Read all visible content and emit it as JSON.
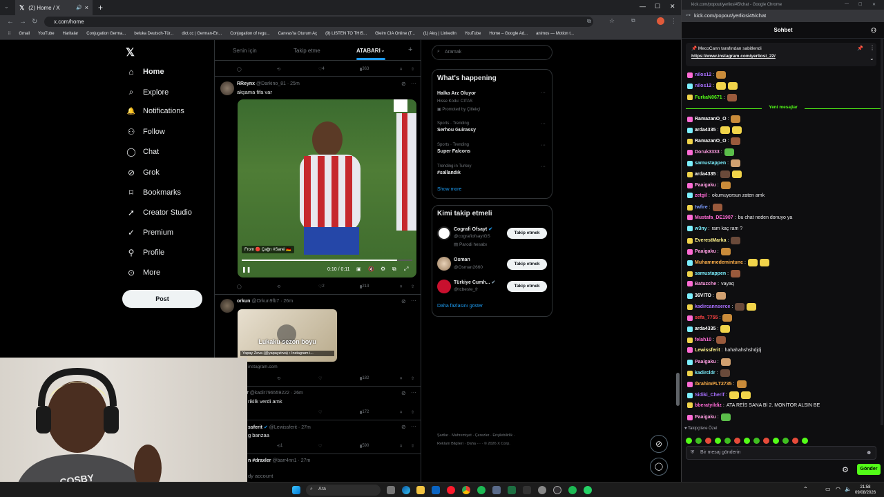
{
  "browser": {
    "tab_title": "(2) Home / X",
    "url": "x.com/home",
    "bookmarks": [
      "Gmail",
      "YouTube",
      "Haritalar",
      "Conjugation Germa...",
      "beluka Deutsch-Tür...",
      "dict.cc | German-En...",
      "Conjugation of regu...",
      "Canvas'ta Oturum Aç",
      "(9) LISTEN TO THIS...",
      "Gleim CIA Online (T...",
      "(1) Akış | LinkedIn",
      "YouTube",
      "Home – Google Ad...",
      "animos — Motion t..."
    ],
    "colors": {
      "chrome_dark": "#202124",
      "chrome_mid": "#35363a"
    }
  },
  "x_nav": {
    "items": [
      {
        "label": "Home",
        "icon": "home-icon"
      },
      {
        "label": "Explore",
        "icon": "search-icon"
      },
      {
        "label": "Notifications",
        "icon": "bell-icon"
      },
      {
        "label": "Follow",
        "icon": "person-plus-icon"
      },
      {
        "label": "Chat",
        "icon": "chat-bubble-icon"
      },
      {
        "label": "Grok",
        "icon": "grok-icon"
      },
      {
        "label": "Bookmarks",
        "icon": "bookmark-icon"
      },
      {
        "label": "Creator Studio",
        "icon": "rocket-icon"
      },
      {
        "label": "Premium",
        "icon": "check-circle-icon"
      },
      {
        "label": "Profile",
        "icon": "person-icon"
      },
      {
        "label": "More",
        "icon": "more-circle-icon"
      }
    ],
    "post_label": "Post"
  },
  "timeline": {
    "tabs": [
      "Senin için",
      "Takip etme",
      "ATABARI"
    ],
    "top_stats": {
      "likes": "4",
      "views": "363"
    },
    "tweets": [
      {
        "name": "RReynx",
        "handle": "@Darkino_81 · 25m",
        "text": "akşama fifa var",
        "video_caption": "From 🔴 Çağrı #Sané 🇩🇪",
        "video_time": "0:10 / 0:11",
        "likes": "2",
        "views": "213"
      },
      {
        "name": "orkun",
        "handle": "@Orkun9fb7 · 26m",
        "card_text": "Lukaku sezon boyu",
        "card_sub": "Yapay Zeva (@yapayzirva) • Instagram i...",
        "card_domain": "instagram.com",
        "views": "182"
      },
      {
        "name": "r",
        "handle": "@kadir796559222 · 26m",
        "text": "rikilk verdi amk",
        "views": "172"
      },
      {
        "name": "ssferit",
        "handle": "@Lewissferit · 27m",
        "text": "g banzaa",
        "retweets": "1",
        "views": "590"
      },
      {
        "name": "n #draxler",
        "handle": "@barr4nn1 · 27m",
        "text": "dy account"
      }
    ]
  },
  "sidebar": {
    "search_placeholder": "Aramak",
    "whats_happening_title": "What's happening",
    "trends": [
      {
        "meta": "",
        "title": "Halka Arz Oluyor",
        "sub": "Hisse Kodu: CITAS",
        "promo": "Promoted by Çitlekçi"
      },
      {
        "meta": "Sports · Trending",
        "title": "Serhou Guirassy"
      },
      {
        "meta": "Sports · Trending",
        "title": "Super Falcons"
      },
      {
        "meta": "Trending in Turkey",
        "title": "#sallandık"
      }
    ],
    "show_more": "Show more",
    "who_to_follow_title": "Kimi takip etmeli",
    "who": [
      {
        "name": "Cografi Ofsayt",
        "handle": "@cografiofsaytGS",
        "note": "Parodi hesabı",
        "btn": "Takip etmek"
      },
      {
        "name": "Osman",
        "handle": "@Osman2660",
        "note": "",
        "btn": "Takip etmek"
      },
      {
        "name": "Türkiye Cumh...",
        "handle": "@tcbeste_fr",
        "note": "",
        "btn": "Takip etmek"
      }
    ],
    "show_more_follow": "Daha fazlasını göster",
    "footer_line1": "Şartlar · Mahremiyet · Çerezler · Erişilebilirlik ·",
    "footer_line2": "Reklam Bilgileri · Daha ··· · © 2026 X Corp."
  },
  "chat": {
    "window_title": "kick.com/popout/yerliosi45/chat - Google Chrome",
    "url": "kick.com/popout/yerliosi45/chat",
    "header": "Sohbet",
    "pinned_by": "MecoCann tarafından sabitlendi",
    "pinned_link": "https://www.instagram.com/yerliosi_22/",
    "new_messages": "Yeni mesajlar",
    "messages_before": [
      {
        "user": "nilos12",
        "text": "",
        "color": "#a970ff"
      },
      {
        "user": "nilos12",
        "text": "",
        "color": "#a970ff"
      },
      {
        "user": "FurkaN0671",
        "text": "",
        "color": "#53fc18"
      }
    ],
    "messages": [
      {
        "user": "RamazanO_O",
        "text": "",
        "color": "#ffffff"
      },
      {
        "user": "arda4335",
        "text": "",
        "color": "#ffffff"
      },
      {
        "user": "RamazanO_O",
        "text": "",
        "color": "#ffffff"
      },
      {
        "user": "Doruk3333",
        "text": "",
        "color": "#ff9de2"
      },
      {
        "user": "samustappen",
        "text": "",
        "color": "#7cf0ff"
      },
      {
        "user": "arda4335",
        "text": "",
        "color": "#ffffff"
      },
      {
        "user": "Paaigaku",
        "text": "",
        "color": "#ff9de2"
      },
      {
        "user": "zetgil",
        "text": "okumuyorsun zaten amk",
        "color": "#ff6bd5"
      },
      {
        "user": "twfire",
        "text": "",
        "color": "#7c9dff"
      },
      {
        "user": "Mustafa_DE1907",
        "text": "bu chat neden donuyo ya",
        "color": "#ff6bd5"
      },
      {
        "user": "w3ny",
        "text": "ram kaç ram ?",
        "color": "#7cf0ff"
      },
      {
        "user": "EverestMarka",
        "text": "",
        "color": "#fff48c"
      },
      {
        "user": "Paaigaku",
        "text": "",
        "color": "#ff9de2"
      },
      {
        "user": "Muhammedemintunc",
        "text": "",
        "color": "#ffb04a"
      },
      {
        "user": "samustappen",
        "text": "",
        "color": "#7cf0ff"
      },
      {
        "user": "Batuzche",
        "text": "vayaq",
        "color": "#ff9de2"
      },
      {
        "user": "36VITO",
        "text": "",
        "color": "#ffffff"
      },
      {
        "user": "kadircannserce",
        "text": "",
        "color": "#a970ff"
      },
      {
        "user": "sefa_7755",
        "text": "",
        "color": "#ff4444"
      },
      {
        "user": "arda4335",
        "text": "",
        "color": "#ffffff"
      },
      {
        "user": "felah10",
        "text": "",
        "color": "#ff6bd5"
      },
      {
        "user": "Lewissferit",
        "text": "hahahahshshdjdj",
        "color": "#fff48c"
      },
      {
        "user": "Paaigaku",
        "text": "",
        "color": "#ff9de2"
      },
      {
        "user": "kadircldr",
        "text": "",
        "color": "#7cf0ff"
      },
      {
        "user": "IbrahimPLT2735",
        "text": "",
        "color": "#ffb04a"
      },
      {
        "user": "Sidiki_Cherif",
        "text": "",
        "color": "#a970ff"
      },
      {
        "user": "bberatyildiz",
        "text": "ATA REİS SANA Bİ 2. MONİTOR ALSIN BE",
        "color": "#ff6bd5"
      },
      {
        "user": "Paaigaku",
        "text": "",
        "color": "#ff9de2"
      }
    ],
    "followers_only": "Takipçilere Özel",
    "input_placeholder": "Bir mesaj gönderin",
    "send_label": "Gönder",
    "accent": "#53fc18"
  },
  "taskbar": {
    "search_label": "Ara",
    "time": "21:58",
    "date": "09/08/2026"
  }
}
